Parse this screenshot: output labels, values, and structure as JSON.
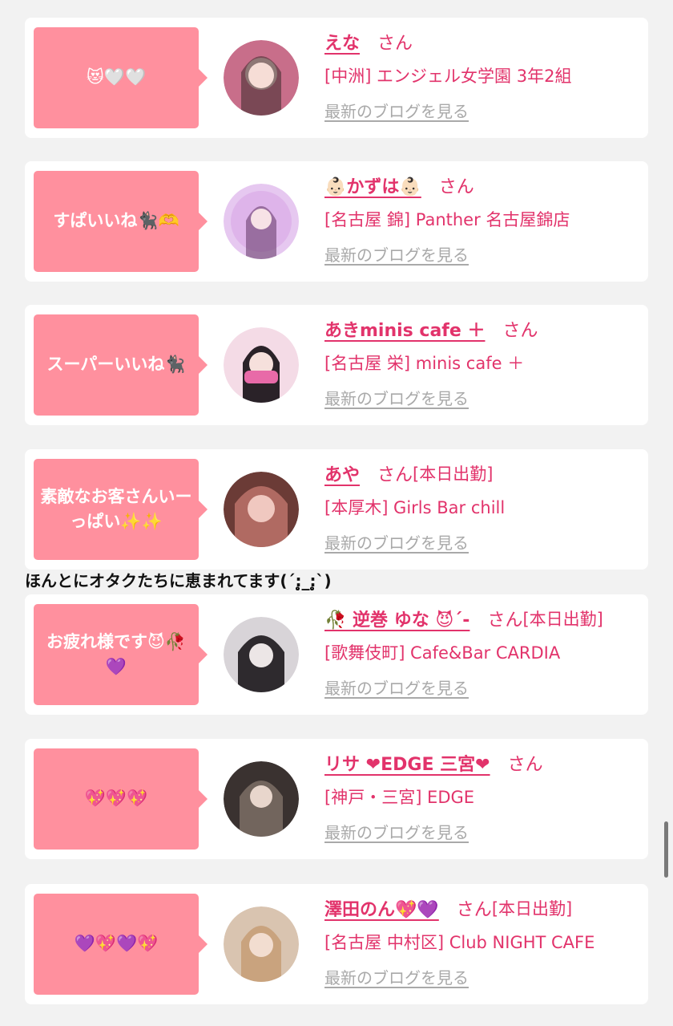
{
  "entries": [
    {
      "bubble": "😻🤍🤍",
      "name": "えな",
      "san": "さん",
      "status": "",
      "shop": "[中洲] エンジェル女学園 3年2組",
      "blog": "最新のブログを見る",
      "avatar_color": "#c86e8a"
    },
    {
      "bubble": "すぱいいね🐈‍⬛🫶",
      "name": "👶🏻かずは👶🏻",
      "san": "さん",
      "status": "",
      "shop": "[名古屋 錦] Panther 名古屋錦店",
      "blog": "最新のブログを見る",
      "avatar_color": "#d9a6e6"
    },
    {
      "bubble": "スーパーいいね🐈‍⬛",
      "name": "あきminis cafe ＋",
      "san": "さん",
      "status": "",
      "shop": "[名古屋 栄] minis cafe ＋",
      "blog": "最新のブログを見る",
      "avatar_color": "#e86aa8"
    },
    {
      "bubble": "素敵なお客さんいーっぱい✨✨",
      "name": "あや",
      "san": "さん",
      "status": "[本日出勤]",
      "shop": "[本厚木] Girls Bar chill",
      "blog": "最新のブログを見る",
      "avatar_color": "#b06a62"
    },
    {
      "bubble": "お疲れ様です😈🥀💜",
      "name": "🥀 逆巻 ゆな 😈´-",
      "san": "さん",
      "status": "[本日出勤]",
      "shop": "[歌舞伎町] Cafe&Bar CARDIA",
      "blog": "最新のブログを見る",
      "avatar_color": "#6e6a6e"
    },
    {
      "bubble": "💖💖💖",
      "name": "リサ ❤EDGE 三宮❤",
      "san": "さん",
      "status": "",
      "shop": "[神戸・三宮] EDGE",
      "blog": "最新のブログを見る",
      "avatar_color": "#8a7a70"
    },
    {
      "bubble": "💜💖💜💖",
      "name": "澤田のん💖💜",
      "san": "さん",
      "status": "[本日出勤]",
      "shop": "[名古屋 中村区] Club NIGHT CAFE",
      "blog": "最新のブログを見る",
      "avatar_color": "#c9a37e"
    }
  ],
  "comment": "ほんとにオタクたちに恵まれてます(´:̥̥̥̥̥̥̥̥_:̥̥̥̥̥̥̥̥`)",
  "colors": {
    "accent": "#e2336b",
    "bubble": "#ff909e",
    "link_gray": "#a9a9a9",
    "background": "#f2f2f2"
  }
}
